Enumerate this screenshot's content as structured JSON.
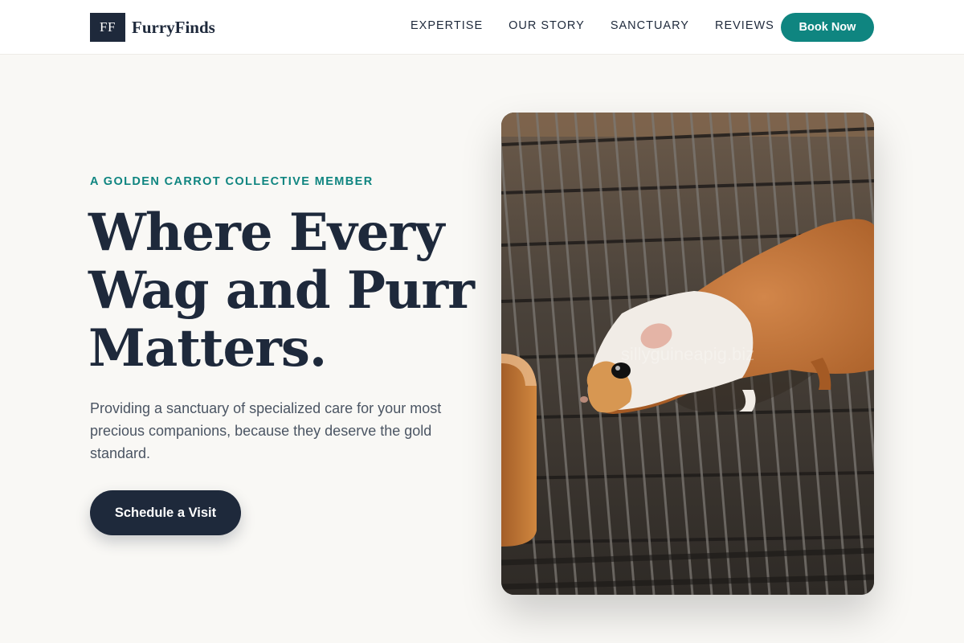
{
  "brand": {
    "logo_text": "FF",
    "name": "FurryFinds"
  },
  "nav": {
    "links": [
      "EXPERTISE",
      "OUR STORY",
      "SANCTUARY",
      "REVIEWS"
    ],
    "book_label": "Book Now"
  },
  "hero": {
    "kicker": "A GOLDEN CARROT COLLECTIVE MEMBER",
    "headline": "Where Every Wag and Purr Matters.",
    "subtitle": "Providing a sanctuary of specialized care for your most precious companions, because they deserve the gold standard.",
    "cta_label": "Schedule a Visit",
    "image_watermark": "sillyguineapig.biz",
    "image_subject": "guinea pig on metal cage grate"
  },
  "colors": {
    "accent": "#0f8580",
    "navy": "#1e293b",
    "background": "#f9f8f5"
  }
}
